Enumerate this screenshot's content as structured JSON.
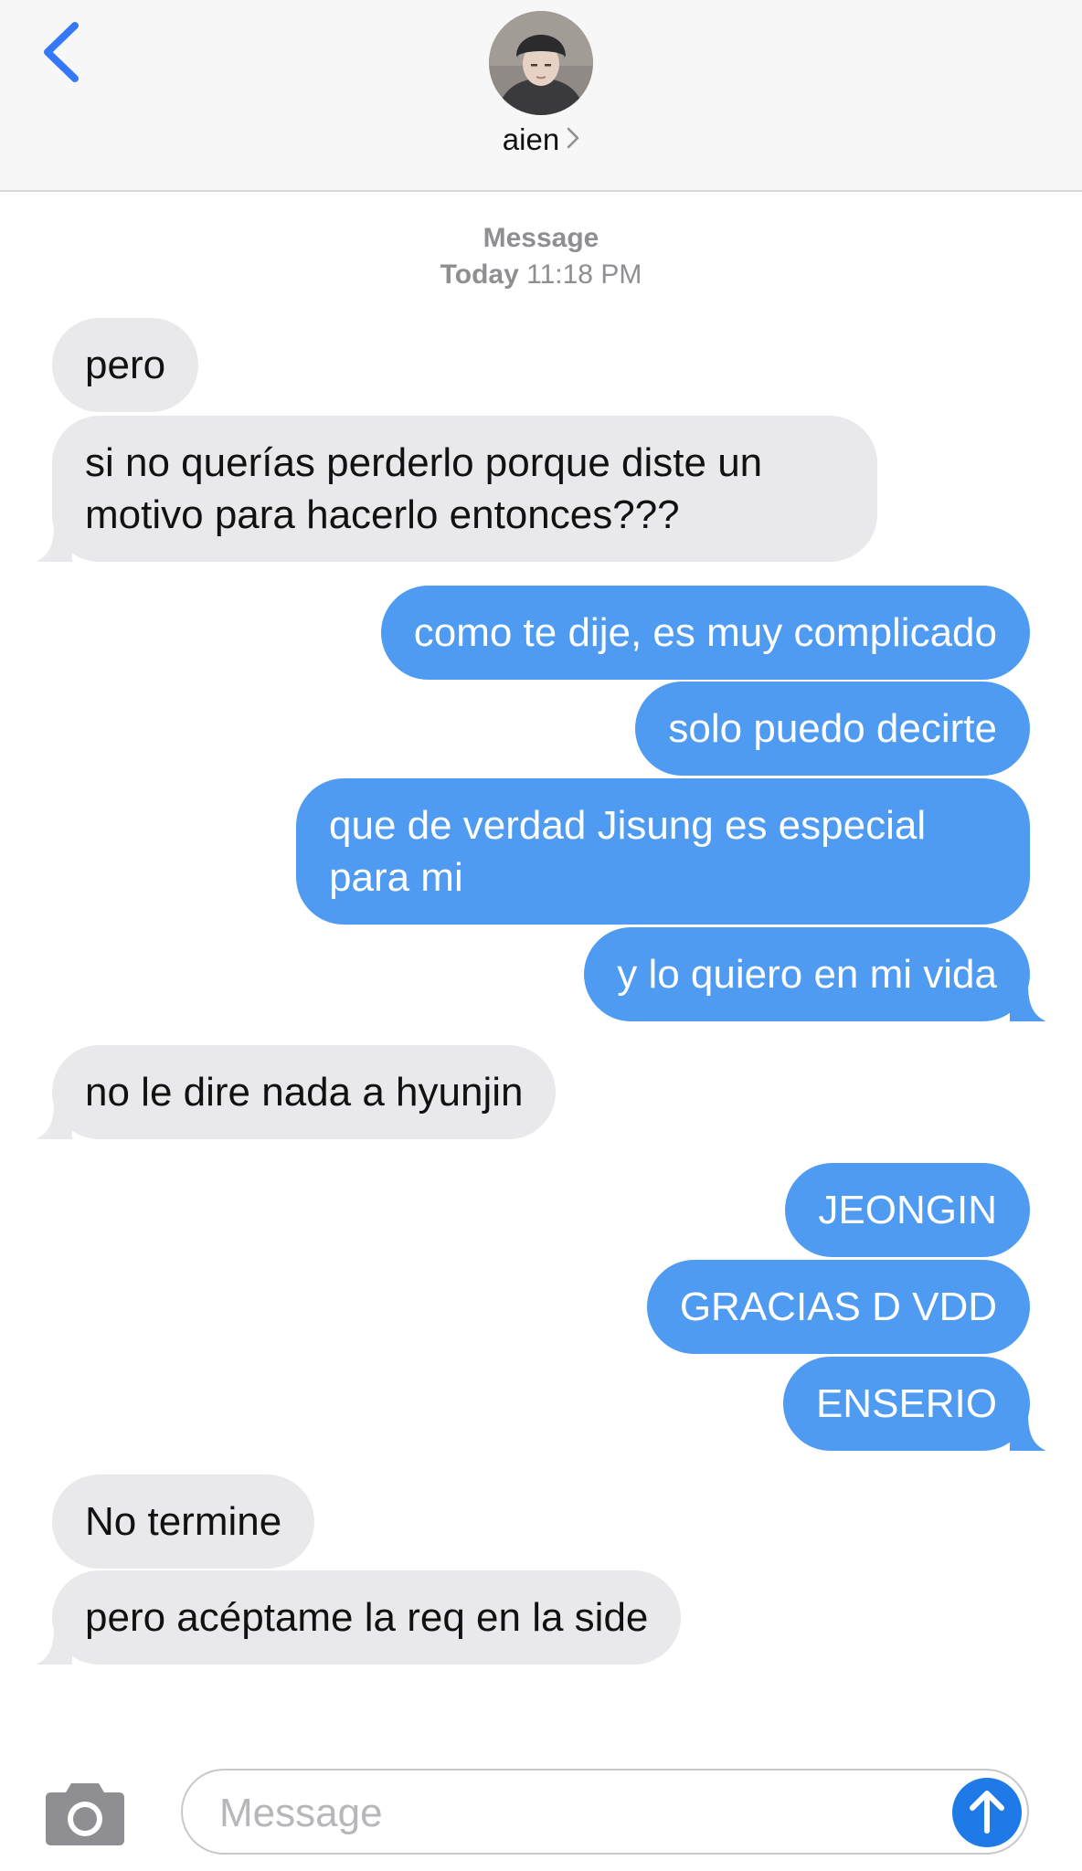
{
  "header": {
    "contact_name": "aien",
    "back_icon": "chevron-left-icon",
    "accent_color": "#3478f6"
  },
  "thread_meta": {
    "label": "Message",
    "day": "Today",
    "time": "11:18 PM"
  },
  "messages": [
    {
      "direction": "incoming",
      "text": "pero"
    },
    {
      "direction": "incoming",
      "text": "si no querías perderlo porque diste un motivo para hacerlo entonces???"
    },
    {
      "direction": "outgoing",
      "text": "como te dije, es muy complicado"
    },
    {
      "direction": "outgoing",
      "text": "solo puedo decirte"
    },
    {
      "direction": "outgoing",
      "text": "que de verdad Jisung es especial para mi"
    },
    {
      "direction": "outgoing",
      "text": "y lo quiero en mi vida"
    },
    {
      "direction": "incoming",
      "text": "no le dire nada a hyunjin"
    },
    {
      "direction": "outgoing",
      "text": "JEONGIN"
    },
    {
      "direction": "outgoing",
      "text": "GRACIAS D VDD"
    },
    {
      "direction": "outgoing",
      "text": "ENSERIO"
    },
    {
      "direction": "incoming",
      "text": "No termine"
    },
    {
      "direction": "incoming",
      "text": "pero acéptame la req en la side"
    }
  ],
  "composer": {
    "placeholder": "Message",
    "value": "",
    "camera_icon": "camera-icon",
    "send_icon": "arrow-up-icon"
  },
  "colors": {
    "incoming_bubble": "#e9e9eb",
    "outgoing_bubble": "#4e9bf1",
    "send_button": "#1f7ae8"
  }
}
